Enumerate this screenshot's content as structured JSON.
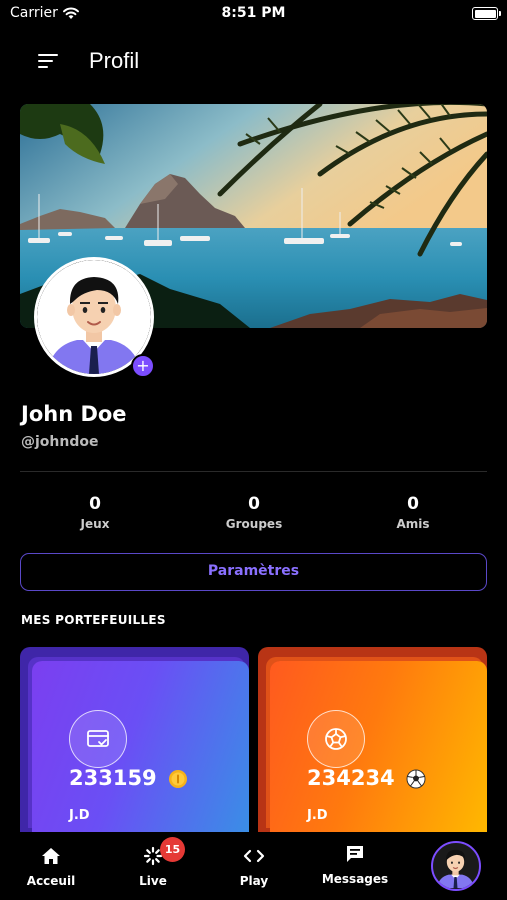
{
  "status_bar": {
    "carrier": "Carrier",
    "time": "8:51 PM"
  },
  "header": {
    "title": "Profil",
    "menu_icon": "menu-icon"
  },
  "profile": {
    "name": "John Doe",
    "handle": "@johndoe",
    "add_photo_symbol": "+"
  },
  "stats": [
    {
      "value": "0",
      "label": "Jeux"
    },
    {
      "value": "0",
      "label": "Groupes"
    },
    {
      "value": "0",
      "label": "Amis"
    }
  ],
  "settings_button": {
    "label": "Paramètres"
  },
  "wallets_section": {
    "title": "MES PORTEFEUILLES",
    "wallets": [
      {
        "amount": "233159",
        "unit_icon": "coin-icon",
        "owner": "J.D",
        "icon": "card-check-icon",
        "colors": [
          "#7b3ff0",
          "#3a8ee6"
        ]
      },
      {
        "amount": "234234",
        "unit_icon": "soccer-ball-icon",
        "owner": "J.D",
        "icon": "soccer-ball-icon",
        "colors": [
          "#ff5a1f",
          "#ffb800"
        ]
      }
    ]
  },
  "tabbar": {
    "tabs": [
      {
        "label": "Acceuil",
        "icon": "home-icon"
      },
      {
        "label": "Live",
        "icon": "live-icon",
        "badge": "15"
      },
      {
        "label": "Play",
        "icon": "code-icon"
      },
      {
        "label": "Messages",
        "icon": "message-icon"
      }
    ],
    "profile_icon": "avatar"
  },
  "colors": {
    "accent": "#7c4dff",
    "background": "#000000",
    "badge": "#e53935"
  }
}
